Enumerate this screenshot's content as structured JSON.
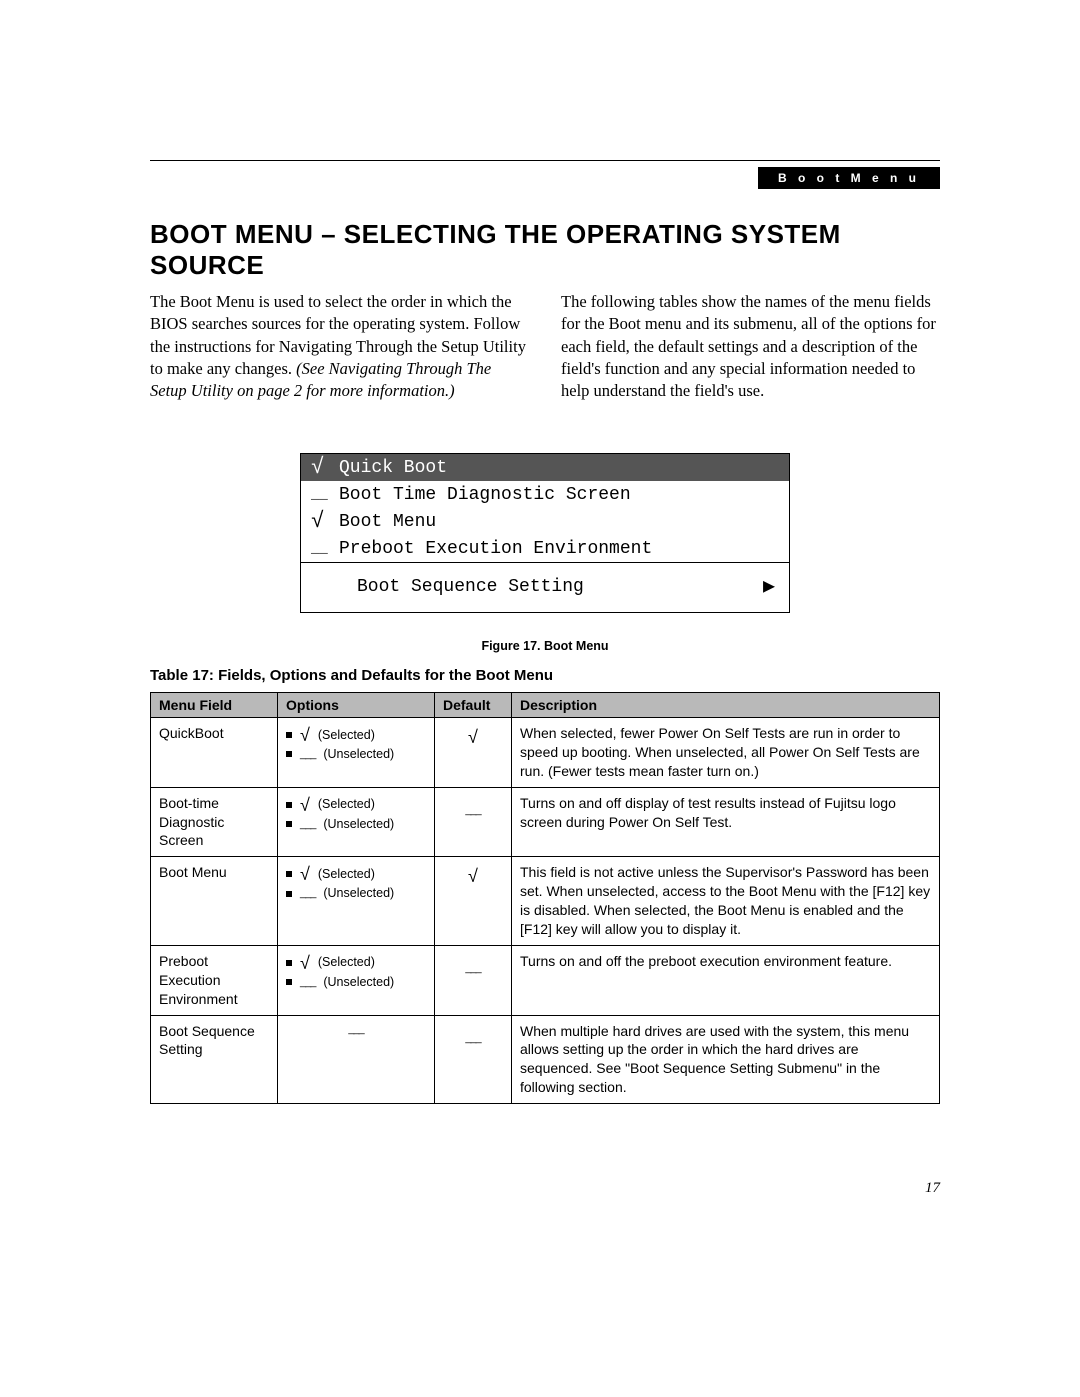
{
  "header": {
    "chip": "B o o t   M e n u"
  },
  "title": "BOOT MENU – SELECTING THE OPERATING SYSTEM SOURCE",
  "intro": {
    "col1": "The Boot Menu is used to select the order in which the BIOS searches sources for the operating system. Follow the instructions for Navigating Through the Setup Utility to make any changes. ",
    "col1_italic": "(See Navigating Through The Setup Utility on page 2 for more information.)",
    "col2": "The following tables show the names of the menu fields for the Boot menu and its submenu, all of the options for each field, the default settings and a description of the field's function and any special information needed to help understand the field's use."
  },
  "bios": {
    "rows": [
      {
        "mark": "√",
        "label": "Quick Boot",
        "hl": true
      },
      {
        "mark": "__",
        "label": "Boot Time Diagnostic Screen",
        "hl": false
      },
      {
        "mark": "√",
        "label": "Boot Menu",
        "hl": false
      },
      {
        "mark": "__",
        "label": "Preboot Execution Environment",
        "hl": false
      }
    ],
    "sub": "Boot Sequence Setting"
  },
  "figure_caption": "Figure 17.  Boot Menu",
  "table_title": "Table 17: Fields, Options and Defaults for the Boot Menu",
  "table": {
    "headers": [
      "Menu Field",
      "Options",
      "Default",
      "Description"
    ],
    "option_labels": {
      "selected": "(Selected)",
      "unselected": "(Unselected)"
    },
    "rows": [
      {
        "field": "QuickBoot",
        "has_options": true,
        "default": "check",
        "desc": "When selected, fewer Power On Self Tests are run in order to speed up booting. When unselected, all Power On Self Tests are run. (Fewer tests mean faster turn on.)"
      },
      {
        "field": "Boot-time Diagnostic Screen",
        "has_options": true,
        "default": "dash",
        "desc": "Turns on and off display of test results instead of Fujitsu logo screen during Power On Self Test."
      },
      {
        "field": "Boot Menu",
        "has_options": true,
        "default": "check",
        "desc": "This field is not active unless the Supervisor's Password has been set. When unselected, access to the Boot Menu with the [F12] key is disabled. When selected, the Boot Menu is enabled and the [F12] key will allow you to display it."
      },
      {
        "field": "Preboot Execution Environment",
        "has_options": true,
        "default": "dash",
        "desc": "Turns on and off the preboot execution environment feature."
      },
      {
        "field": "Boot Sequence Setting",
        "has_options": false,
        "default": "dash",
        "desc": "When multiple hard drives are used with the system, this menu allows setting up the order in which the hard drives are sequenced. See \"Boot Sequence Setting Submenu\" in the following section."
      }
    ]
  },
  "page_number": "17"
}
